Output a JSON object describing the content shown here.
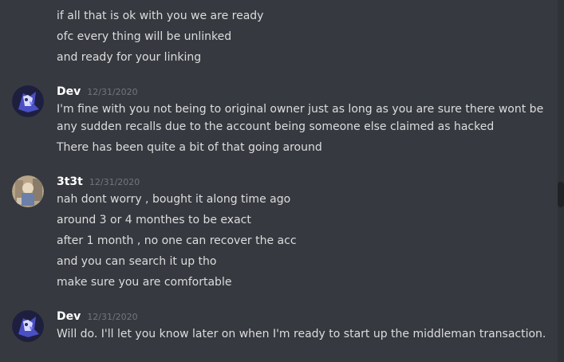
{
  "messages_top": [
    "if all that is ok with you we are ready",
    "ofc every thing will be unlinked",
    "and ready for your linking"
  ],
  "group1": {
    "username": "Dev",
    "timestamp": "12/31/2020",
    "lines": [
      "I'm fine with you not being to original owner just as long as you are sure there wont be",
      "any sudden recalls due to the account being someone else claimed as hacked",
      "There has been quite a bit of that going around"
    ]
  },
  "group2": {
    "username": "3t3t",
    "timestamp": "12/31/2020",
    "lines": [
      "nah dont worry , bought it along time ago",
      "around 3 or 4 monthes to be exact",
      "after 1 month , no one can recover the acc",
      "and you can search it up tho",
      "make sure you are comfortable"
    ]
  },
  "group3": {
    "username": "Dev",
    "timestamp": "12/31/2020",
    "lines": [
      "Will do. I'll let you know later on when I'm ready to start up the middleman transaction."
    ]
  },
  "colors": {
    "background": "#36393f",
    "text": "#dcddde",
    "username": "#ffffff",
    "timestamp": "#72767d",
    "dev_avatar": "#2b2d5c",
    "dev_avatar_accent": "#7b7fff"
  }
}
